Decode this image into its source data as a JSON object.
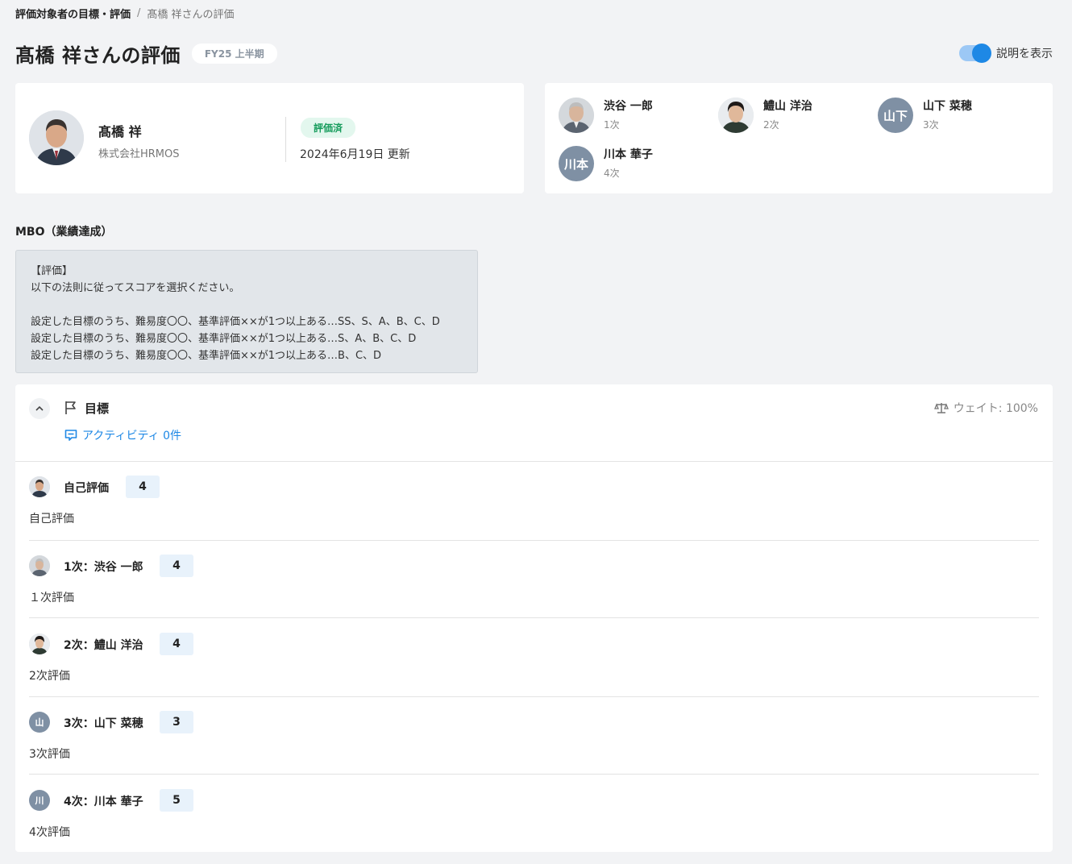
{
  "breadcrumb": {
    "parent": "評価対象者の目標・評価",
    "separator": "/",
    "current": "髙橋 祥さんの評価"
  },
  "header": {
    "title": "髙橋 祥さんの評価",
    "period": "FY25 上半期",
    "toggle_label": "説明を表示",
    "toggle_on": true
  },
  "profile": {
    "name": "髙橋 祥",
    "company": "株式会社HRMOS",
    "status": "評価済",
    "updated": "2024年6月19日 更新"
  },
  "evaluators": [
    {
      "name": "渋谷 一郎",
      "level": "1次",
      "avatar": "photo-older"
    },
    {
      "name": "鱧山 洋治",
      "level": "2次",
      "avatar": "photo-young"
    },
    {
      "name": "山下 菜穂",
      "level": "3次",
      "initials": "山下"
    },
    {
      "name": "川本 華子",
      "level": "4次",
      "initials": "川本"
    }
  ],
  "section": {
    "title": "MBO（業績達成）"
  },
  "instruction": {
    "lines": [
      "【評価】",
      "以下の法則に従ってスコアを選択ください。",
      "",
      "設定した目標のうち、難易度〇〇、基準評価××が1つ以上ある…SS、S、A、B、C、D",
      "設定した目標のうち、難易度〇〇、基準評価××が1つ以上ある…S、A、B、C、D",
      "設定した目標のうち、難易度〇〇、基準評価××が1つ以上ある…B、C、D"
    ]
  },
  "goal": {
    "title": "目標",
    "activity": "アクティビティ 0件",
    "weight": "ウェイト: 100%"
  },
  "evaluations": [
    {
      "label": "自己評価",
      "score": "4",
      "comment": "自己評価",
      "avatar": "photo-self"
    },
    {
      "label": "1次：渋谷 一郎",
      "score": "4",
      "comment": "１次評価",
      "avatar": "photo-older"
    },
    {
      "label": "2次：鱧山 洋治",
      "score": "4",
      "comment": "2次評価",
      "avatar": "photo-young"
    },
    {
      "label": "3次：山下 菜穂",
      "score": "3",
      "comment": "3次評価",
      "initials": "山"
    },
    {
      "label": "4次：川本 華子",
      "score": "5",
      "comment": "4次評価",
      "initials": "川"
    }
  ],
  "colors": {
    "accent": "#1e88e5",
    "status_bg": "#e3f7ee",
    "status_text": "#169c5c",
    "initials_bg": "#7f90a4",
    "score_bg": "#e8f2fb"
  }
}
